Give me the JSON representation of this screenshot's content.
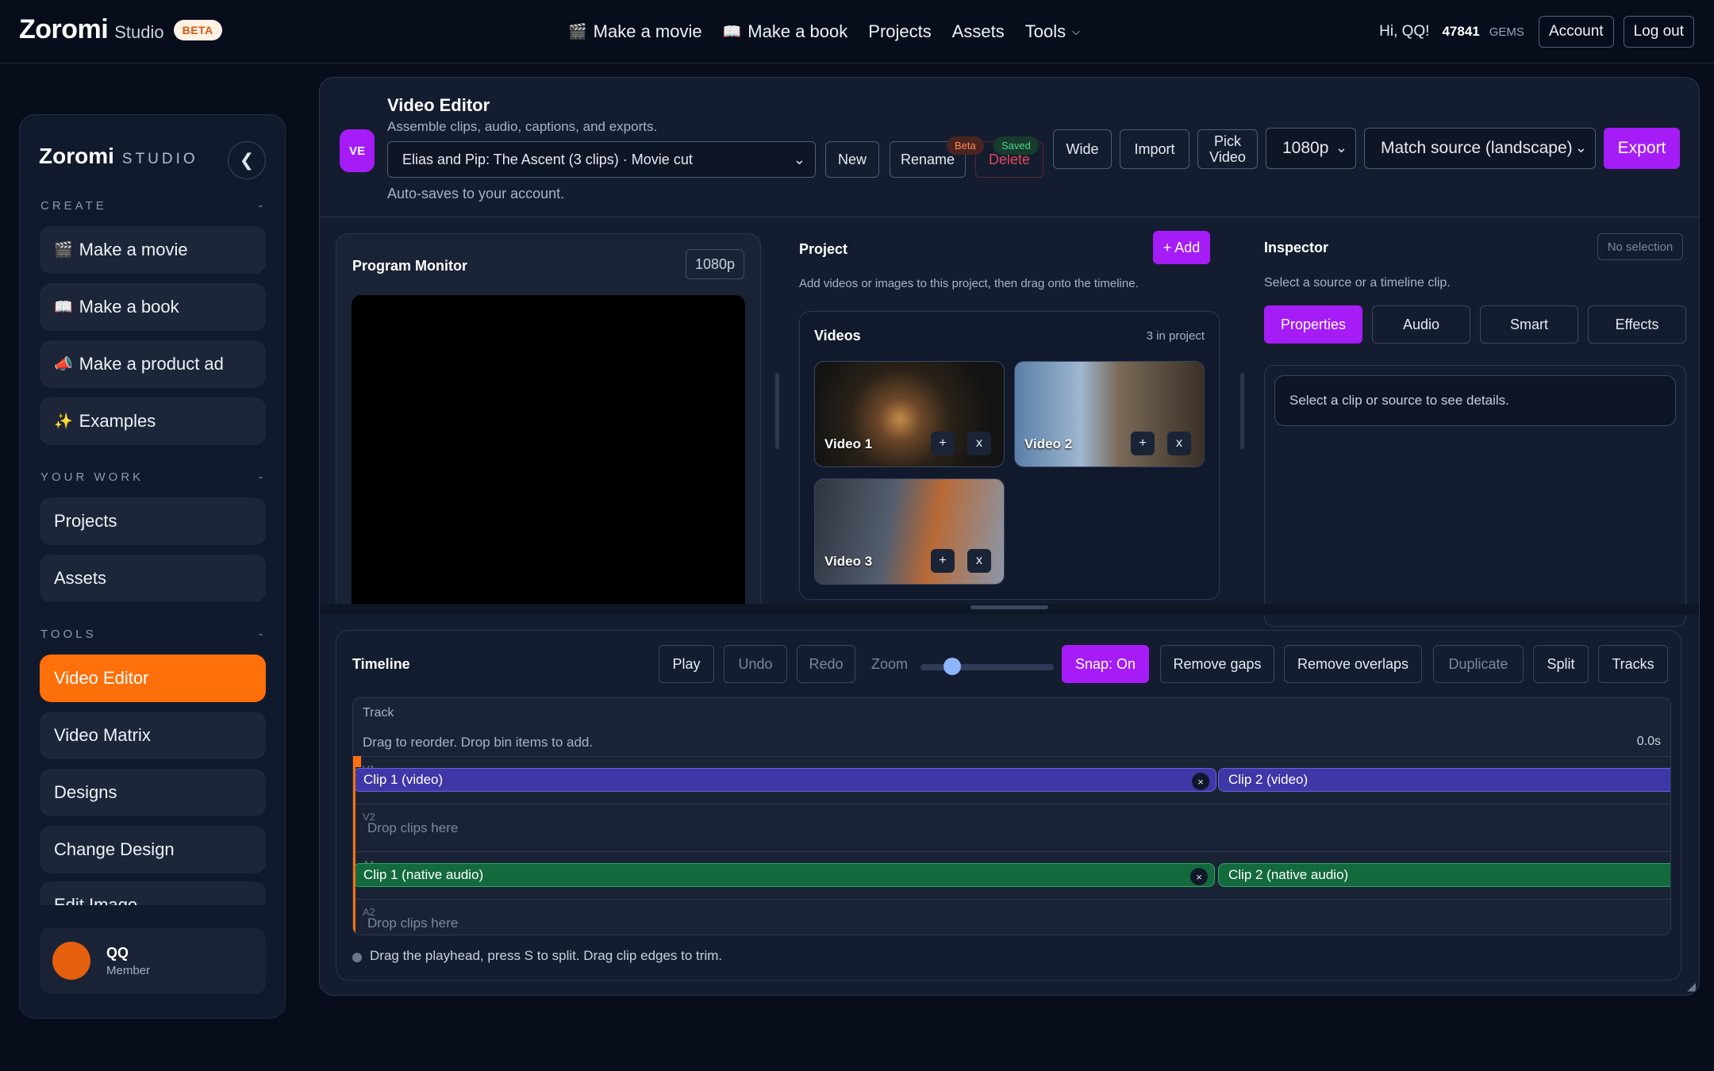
{
  "brand": {
    "name": "Zoromi",
    "sub": "Studio",
    "badge": "BETA"
  },
  "topnav": {
    "make_movie": "Make a movie",
    "make_book": "Make a book",
    "projects": "Projects",
    "assets": "Assets",
    "tools": "Tools"
  },
  "user": {
    "greeting": "Hi, QQ!",
    "gems": "47841",
    "gems_label": "GEMS",
    "account": "Account",
    "logout": "Log out"
  },
  "sidebar": {
    "brand_name": "Zoromi",
    "brand_sub": "STUDIO",
    "sections": {
      "create": "CREATE",
      "your_work": "YOUR WORK",
      "tools": "TOOLS",
      "collapse_mark": "-"
    },
    "create_items": [
      "Make a movie",
      "Make a book",
      "Make a product ad",
      "Examples"
    ],
    "work_items": [
      "Projects",
      "Assets"
    ],
    "tool_items": [
      "Video Editor",
      "Video Matrix",
      "Designs",
      "Change Design",
      "Edit Image"
    ],
    "active_item": "Video Editor",
    "profile": {
      "name": "QQ",
      "role": "Member",
      "avatar_color": "#e4600f"
    }
  },
  "editor": {
    "badge": "VE",
    "title": "Video Editor",
    "subtitle": "Assemble clips, audio, captions, and exports.",
    "project_name": "Elias and Pip: The Ascent (3 clips) · Movie cut",
    "autosave": "Auto-saves to your account.",
    "buttons": {
      "new": "New",
      "rename": "Rename",
      "delete": "Delete",
      "wide": "Wide",
      "import": "Import",
      "pick_video_1": "Pick",
      "pick_video_2": "Video",
      "export": "Export"
    },
    "badges": {
      "beta": "Beta",
      "saved": "Saved"
    },
    "resolution": "1080p",
    "aspect": "Match source (landscape)"
  },
  "monitor": {
    "title": "Program Monitor",
    "resolution": "1080p"
  },
  "project": {
    "title": "Project",
    "add": "+ Add",
    "hint": "Add videos or images to this project, then drag onto the timeline.",
    "videos_title": "Videos",
    "count": "3 in project",
    "videos": [
      {
        "label": "Video 1",
        "add": "+",
        "remove": "x"
      },
      {
        "label": "Video 2",
        "add": "+",
        "remove": "x"
      },
      {
        "label": "Video 3",
        "add": "+",
        "remove": "x"
      }
    ]
  },
  "inspector": {
    "title": "Inspector",
    "selection": "No selection",
    "hint": "Select a source or a timeline clip.",
    "tabs": [
      "Properties",
      "Audio",
      "Smart",
      "Effects"
    ],
    "active_tab": "Properties",
    "detail": "Select a clip or source to see details."
  },
  "timeline": {
    "title": "Timeline",
    "buttons": {
      "play": "Play",
      "undo": "Undo",
      "redo": "Redo",
      "zoom": "Zoom",
      "snap": "Snap: On",
      "remove_gaps": "Remove gaps",
      "remove_overlaps": "Remove overlaps",
      "duplicate": "Duplicate",
      "split": "Split",
      "tracks": "Tracks"
    },
    "zoom_level": 0.2,
    "track_header": "Track",
    "track_hint": "Drag to reorder. Drop bin items to add.",
    "time": "0.0s",
    "lanes": {
      "v1": "V1",
      "v2": "V2",
      "a1": "A1",
      "a2": "A2"
    },
    "drop_hint": "Drop clips here",
    "video_clips": [
      "Clip 1 (video)",
      "Clip 2 (video)"
    ],
    "audio_clips": [
      "Clip 1 (native audio)",
      "Clip 2 (native audio)"
    ],
    "clip_remove": "×",
    "footer": "Drag the playhead, press S to split. Drag clip edges to trim."
  },
  "colors": {
    "accent": "#a51cf7",
    "active_nav": "#ff700a",
    "video_clip": "#3f37a8",
    "audio_clip": "#136a3d"
  }
}
